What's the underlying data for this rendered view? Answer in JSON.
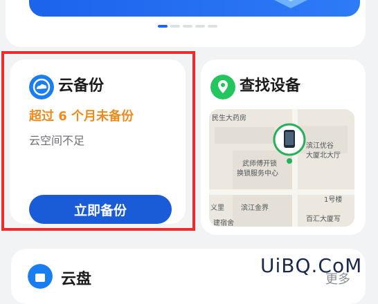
{
  "backup": {
    "title": "云备份",
    "warning": "超过 6 个月未备份",
    "subtitle": "云空间不足",
    "button_label": "立即备份"
  },
  "find_device": {
    "title": "查找设备",
    "map_labels": [
      "民生大药房",
      "滨江优谷",
      "大厦北大厅",
      "武师傅开锁",
      "换锁服务中心",
      "义里",
      "滨江金界",
      "1号楼",
      "百汇大厦写",
      "建宿舍"
    ]
  },
  "drive": {
    "title": "云盘",
    "more_label": "更多"
  },
  "watermark": "UiBQ.CoM",
  "colors": {
    "accent": "#1a5cd8",
    "warning": "#f08a1b",
    "highlight": "#ef2b2b",
    "find_icon": "#22c55e"
  }
}
